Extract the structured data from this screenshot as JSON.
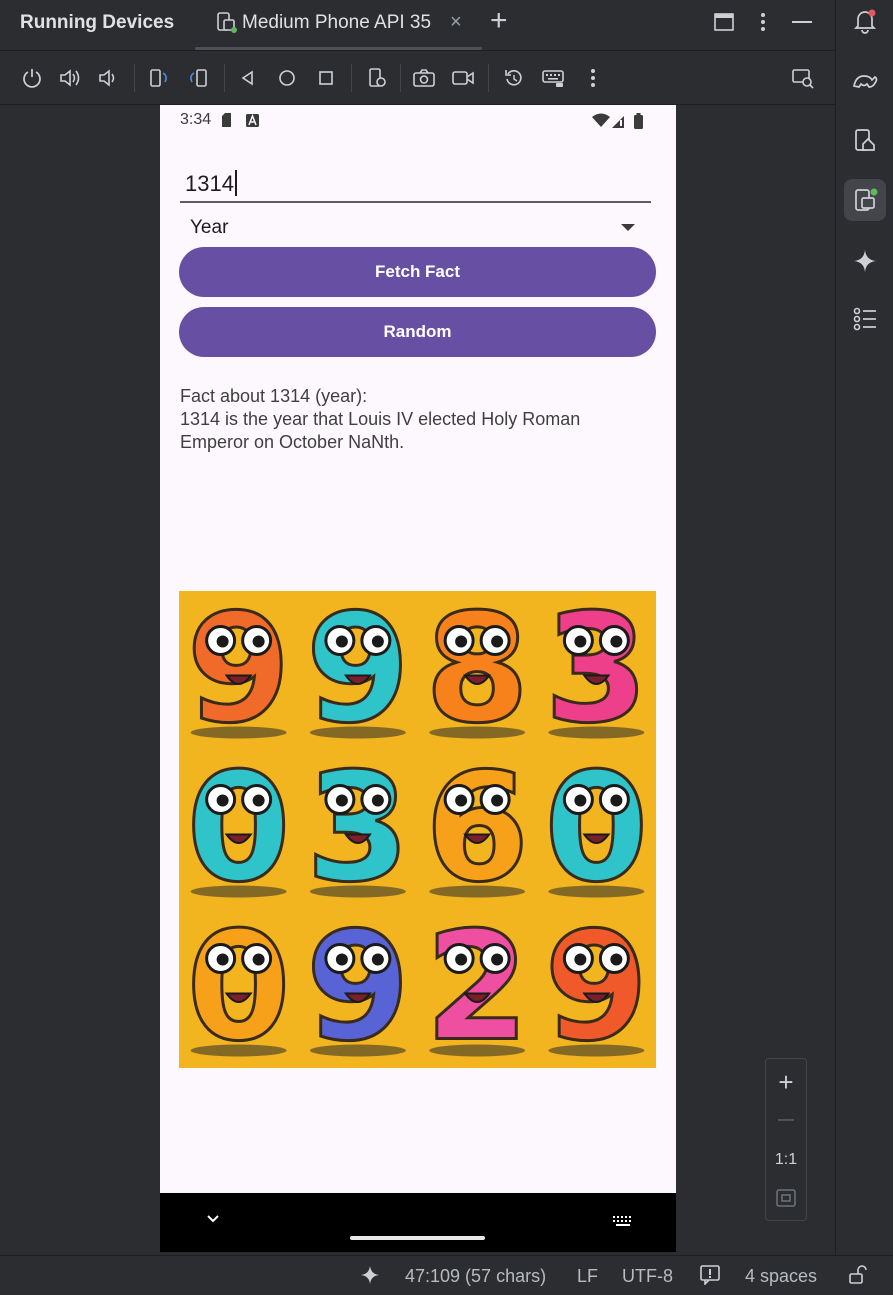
{
  "panel": {
    "title": "Running Devices"
  },
  "tab": {
    "label": "Medium Phone API 35",
    "close_glyph": "×",
    "add_glyph": "+"
  },
  "toolbar": {
    "icons": [
      "power-icon",
      "volume-up-icon",
      "volume-down-icon",
      "rotate-left-icon",
      "rotate-right-icon",
      "back-icon",
      "home-icon",
      "overview-icon",
      "device-settings-icon",
      "screenshot-icon",
      "screen-record-icon",
      "reset-icon",
      "keyboard-icon",
      "more-icon",
      "device-mirroring-icon"
    ]
  },
  "phone": {
    "status": {
      "time": "3:34"
    },
    "input": {
      "value": "1314"
    },
    "dropdown": {
      "selected": "Year"
    },
    "buttons": {
      "fetch": "Fetch Fact",
      "random": "Random"
    },
    "fact": {
      "heading": "Fact about 1314 (year):",
      "body": "1314 is the year that Louis IV elected Holy Roman Emperor on October NaNth."
    },
    "illustration": {
      "digits": [
        "9",
        "9",
        "8",
        "3",
        "0",
        "3",
        "6",
        "0",
        "0",
        "9",
        "2",
        "9"
      ],
      "colors": [
        "#f06a2a",
        "#2ec4c9",
        "#f7821b",
        "#ee3f8b",
        "#2ec4c9",
        "#2ec4c9",
        "#f7a11b",
        "#2ec4c9",
        "#f7a11b",
        "#5863d6",
        "#ef4fa0",
        "#f05a2a"
      ]
    }
  },
  "zoom": {
    "in": "+",
    "out": "—",
    "actual": "1:1"
  },
  "statusline": {
    "position": "47:109 (57 chars)",
    "line_ending": "LF",
    "encoding": "UTF-8",
    "indent": "4 spaces"
  },
  "colors": {
    "accent": "#6750a4",
    "ide_bg": "#2b2d30",
    "phone_bg": "#fdf7fe"
  }
}
